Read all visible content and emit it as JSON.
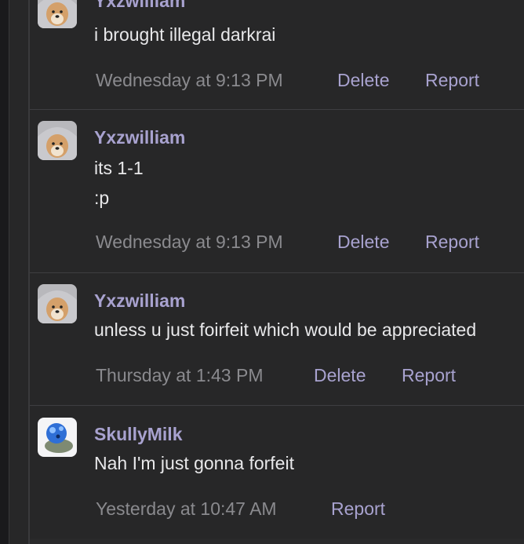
{
  "comments": [
    {
      "username": "Yxzwilliam",
      "avatar": "doge-hooded-avatar",
      "lines": [
        "i brought illegal darkrai"
      ],
      "timestamp": "Wednesday at 9:13 PM",
      "actions": [
        "Delete",
        "Report"
      ]
    },
    {
      "username": "Yxzwilliam",
      "avatar": "doge-hooded-avatar",
      "lines": [
        "its 1-1",
        ":p"
      ],
      "timestamp": "Wednesday at 9:13 PM",
      "actions": [
        "Delete",
        "Report"
      ]
    },
    {
      "username": "Yxzwilliam",
      "avatar": "doge-hooded-avatar",
      "lines": [
        "unless u just foirfeit which would be appreciated"
      ],
      "timestamp": "Thursday at 1:43 PM",
      "actions": [
        "Delete",
        "Report"
      ]
    },
    {
      "username": "SkullyMilk",
      "avatar": "blue-creature-avatar",
      "lines": [
        "Nah I'm just gonna forfeit"
      ],
      "timestamp": "Yesterday at 10:47 AM",
      "actions": [
        "Report"
      ]
    }
  ],
  "colors": {
    "background": "#272728",
    "username": "#a8a2cf",
    "text": "#e8e8ea",
    "muted": "#8a8a8e",
    "divider": "#3e3e41"
  }
}
